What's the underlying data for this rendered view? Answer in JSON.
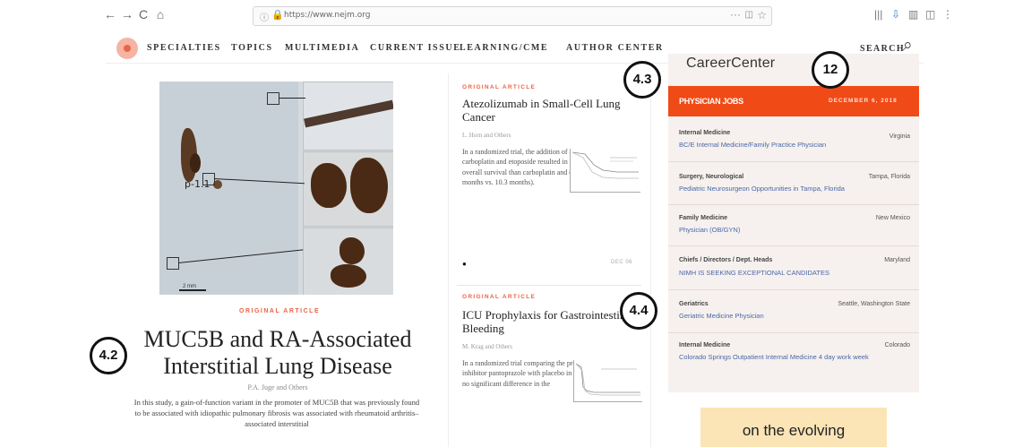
{
  "browser": {
    "back_icon": "←",
    "forward_icon": "→",
    "reload_icon": "C",
    "home_icon": "⌂",
    "info_icon": "ⓘ",
    "lock_icon": "🔒",
    "url": "https://www.nejm.org",
    "menu_dots": "···",
    "pocket_icon": "◫",
    "star_icon": "☆",
    "library_icon": "|||",
    "download_icon": "⇩",
    "sidebar_icon": "▥",
    "reader_icon": "◫",
    "overflow_icon": "⋮"
  },
  "site_nav": {
    "items": [
      "SPECIALTIES",
      "TOPICS",
      "MULTIMEDIA",
      "CURRENT ISSUE",
      "LEARNING/CME",
      "AUTHOR CENTER"
    ],
    "search_label": "SEARCH"
  },
  "featured": {
    "image_label": "p-1.1",
    "scale_label": "2 mm",
    "tag": "ORIGINAL ARTICLE",
    "title": "MUC5B and RA-Associated Interstitial Lung Disease",
    "authors": "P.A. Juge and Others",
    "summary": "In this study, a gain-of-function variant in the promoter of MUC5B that was previously found to be associated with idiopathic pulmonary fibrosis was associated with rheumatoid arthritis–associated interstitial"
  },
  "articles": [
    {
      "tag": "ORIGINAL ARTICLE",
      "title": "Atezolizumab in Small-Cell Lung Cancer",
      "authors": "L. Horn and Others",
      "summary": "In a randomized trial, the addition of atezolizumab to carboplatin and etoposide resulted in significantly longer overall survival than carboplatin and etoposide alone (12.3 months vs. 10.3 months).",
      "comment_icon": "●",
      "date": "DEC 06"
    },
    {
      "tag": "ORIGINAL ARTICLE",
      "title": "ICU Prophylaxis for Gastrointestinal Bleeding",
      "authors": "M. Krag and Others",
      "summary": "In a randomized trial comparing the proton-pump inhibitor pantoprazole with placebo in the ICU, there was no significant difference in the"
    }
  ],
  "career": {
    "title": "CareerCenter",
    "jobs_label": "PHYSICIAN JOBS",
    "date": "DECEMBER 6, 2018",
    "jobs": [
      {
        "category": "Internal Medicine",
        "location": "Virginia",
        "title": "BC/E Internal Medicine/Family Practice Physician"
      },
      {
        "category": "Surgery, Neurological",
        "location": "Tampa, Florida",
        "title": "Pediatric Neurosurgeon Opportunities in Tampa, Florida"
      },
      {
        "category": "Family Medicine",
        "location": "New Mexico",
        "title": "Physician (OB/GYN)"
      },
      {
        "category": "Chiefs / Directors / Dept. Heads",
        "location": "Maryland",
        "title": "NIMH IS SEEKING EXCEPTIONAL CANDIDATES"
      },
      {
        "category": "Geriatrics",
        "location": "Seattle, Washington State",
        "title": "Geriatric Medicine Physician"
      },
      {
        "category": "Internal Medicine",
        "location": "Colorado",
        "title": "Colorado Springs Outpatient Internal Medicine 4 day work week"
      }
    ]
  },
  "ad": {
    "text": "on the evolving"
  },
  "markers": {
    "m1": "4.3",
    "m2": "12",
    "m3": "4.4",
    "m4": "4.2"
  },
  "colors": {
    "accent": "#e8644a",
    "jobs_bar": "#f04a16",
    "link": "#4a67a6",
    "panel": "#f6f1ee"
  }
}
